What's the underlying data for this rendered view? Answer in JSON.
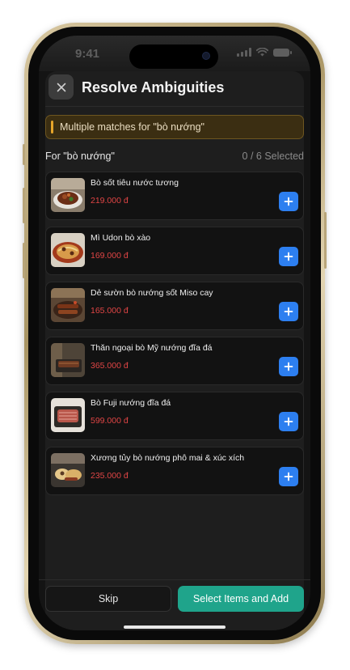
{
  "status_bar": {
    "time": "9:41"
  },
  "sheet": {
    "title": "Resolve Ambiguities",
    "banner_text": "Multiple matches for \"bò nướng\"",
    "for_label": "For \"bò nướng\"",
    "selected_count": "0 / 6  Selected"
  },
  "items": [
    {
      "name": "Bò sốt tiêu nước tương",
      "price": "219.000 đ"
    },
    {
      "name": "Mì Udon bò xào",
      "price": "169.000 đ"
    },
    {
      "name": "Dẻ sườn bò nướng sốt Miso cay",
      "price": "165.000 đ"
    },
    {
      "name": "Thăn ngoại bò Mỹ nướng đĩa đá",
      "price": "365.000 đ"
    },
    {
      "name": "Bò Fuji nướng đĩa đá",
      "price": "599.000 đ"
    },
    {
      "name": "Xương tủy bò nướng phô mai & xúc xích",
      "price": "235.000 đ"
    }
  ],
  "footer": {
    "skip_label": "Skip",
    "primary_label": "Select Items and Add"
  },
  "colors": {
    "accent_teal": "#1fa48b",
    "add_button_blue": "#2d7ff0",
    "price_red": "#e04545",
    "warning_amber": "#e7a52a"
  },
  "icons": {
    "close": "close-icon",
    "add": "plus-icon"
  }
}
